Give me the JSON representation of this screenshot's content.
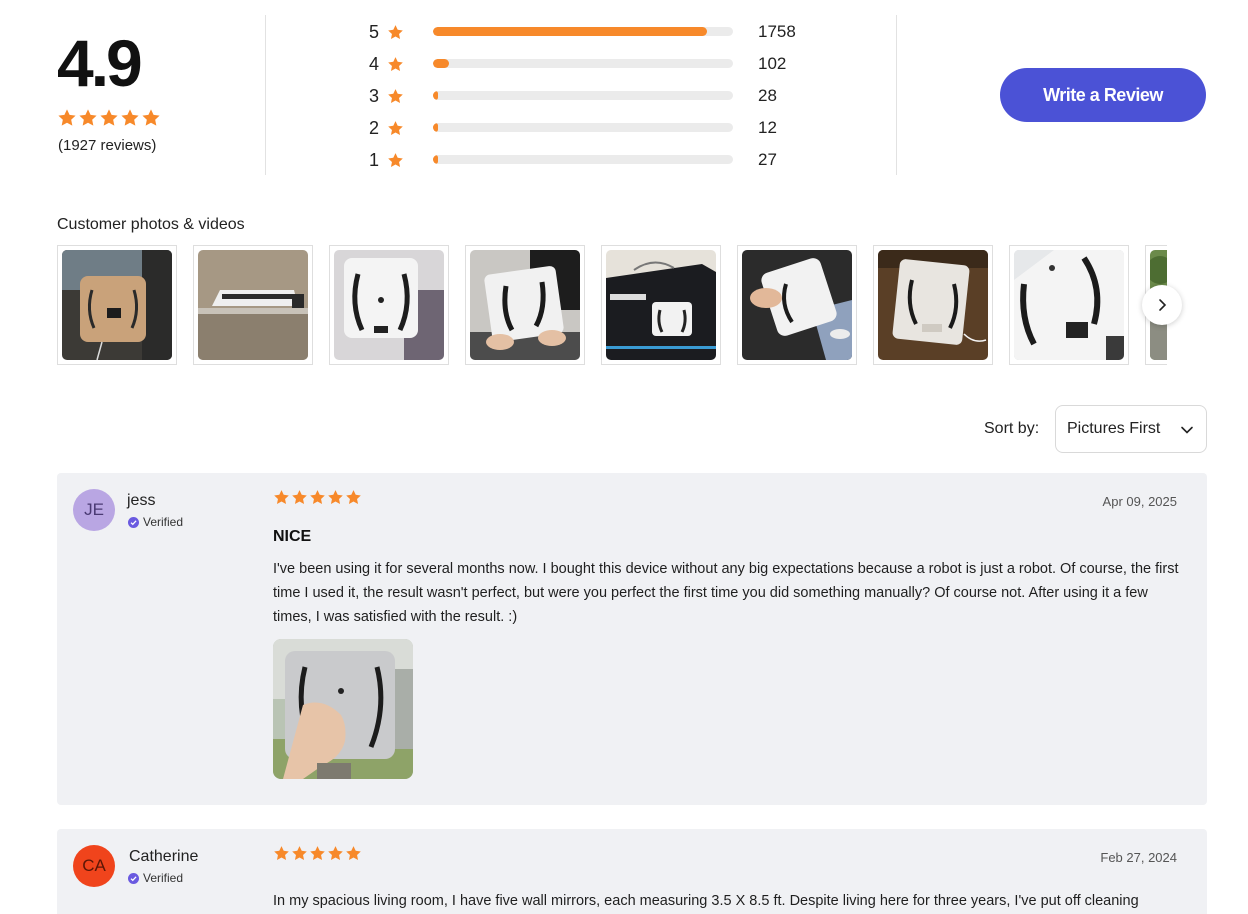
{
  "summary": {
    "average": "4.9",
    "average_stars": 5,
    "review_count": "(1927 reviews)",
    "distribution": [
      {
        "stars": "5",
        "count": "1758",
        "fraction": 0.912
      },
      {
        "stars": "4",
        "count": "102",
        "fraction": 0.053
      },
      {
        "stars": "3",
        "count": "28",
        "fraction": 0.015
      },
      {
        "stars": "2",
        "count": "12",
        "fraction": 0.006
      },
      {
        "stars": "1",
        "count": "27",
        "fraction": 0.014
      }
    ],
    "write_review_label": "Write a Review"
  },
  "photos": {
    "title": "Customer photos & videos",
    "items": [
      "robot-on-window-photo",
      "robot-on-table-photo",
      "robot-held-photo",
      "robot-held-lap-photo",
      "robot-box-photo",
      "robot-in-hand-photo",
      "robot-on-floor-photo",
      "robot-closeup-photo",
      "outdoor-photo"
    ],
    "next_icon": "chevron-right-icon"
  },
  "sort": {
    "label": "Sort by:",
    "selected": "Pictures First"
  },
  "colors": {
    "star": "#f7892a",
    "accent": "#4b52d6",
    "verified": "#6a5ae0"
  },
  "reviews": [
    {
      "initials": "JE",
      "author": "jess",
      "verified": "Verified",
      "rating": 5,
      "date": "Apr 09, 2025",
      "title": "NICE",
      "body": "I've been using it for several months now. I bought this device without any big expectations because a robot is just a robot. Of course, the first time I used it, the result wasn't perfect, but were you perfect the first time you did something manually? Of course not. After using it a few times, I was satisfied with the result. :)",
      "avatar_bg": "#b9a6e3"
    },
    {
      "initials": "CA",
      "author": "Catherine",
      "verified": "Verified",
      "rating": 5,
      "date": "Feb 27, 2024",
      "body": "In my spacious living room, I have five wall mirrors, each measuring 3.5 X 8.5 ft. Despite living here for three years, I've put off cleaning",
      "avatar_bg": "#f0441c"
    }
  ]
}
